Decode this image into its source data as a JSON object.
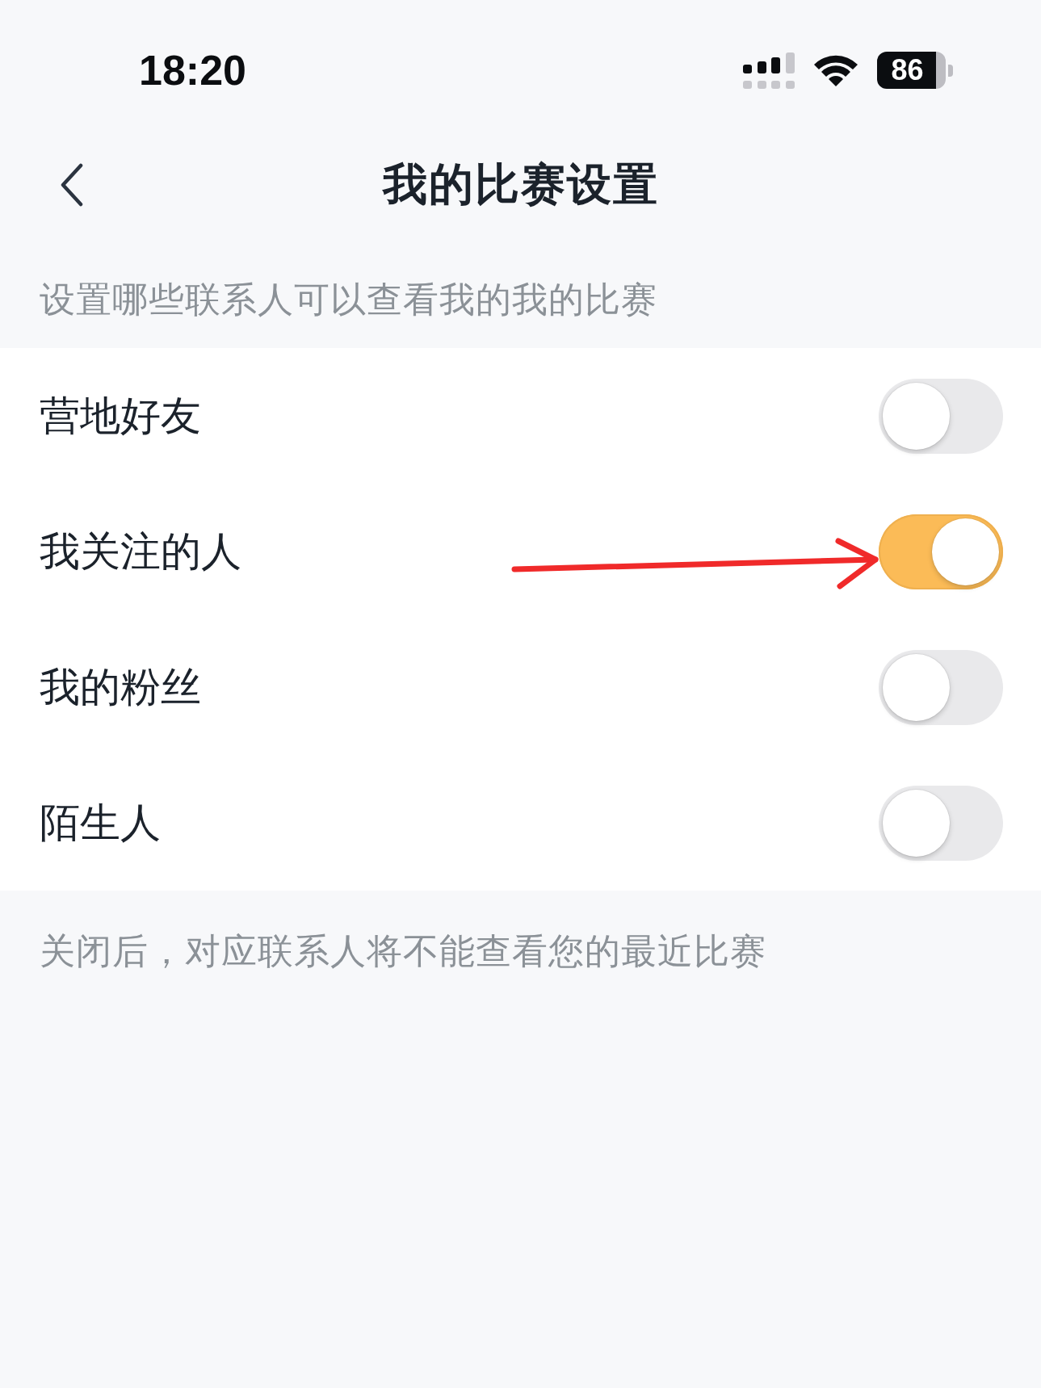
{
  "status_bar": {
    "time": "18:20",
    "battery": "86"
  },
  "header": {
    "title": "我的比赛设置"
  },
  "description": "设置哪些联系人可以查看我的我的比赛",
  "settings": [
    {
      "label": "营地好友",
      "on": false,
      "pointed_at": false
    },
    {
      "label": "我关注的人",
      "on": true,
      "pointed_at": true
    },
    {
      "label": "我的粉丝",
      "on": false,
      "pointed_at": false
    },
    {
      "label": "陌生人",
      "on": false,
      "pointed_at": false
    }
  ],
  "footnote": "关闭后，对应联系人将不能查看您的最近比赛"
}
